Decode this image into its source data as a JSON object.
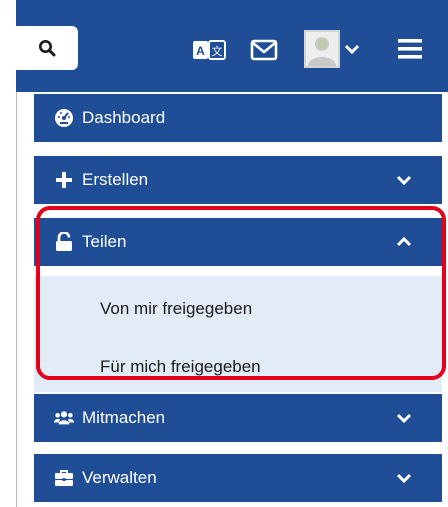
{
  "header": {
    "search_icon": "search-icon",
    "language_icon": "translate-icon",
    "mail_icon": "mail-icon",
    "avatar_icon": "user-avatar-icon",
    "menu_icon": "hamburger-menu-icon",
    "colors": {
      "brand": "#1f4e97",
      "highlight": "#e3001b",
      "submenu": "#e2ecf6"
    }
  },
  "menu": {
    "items": [
      {
        "label": "Dashboard",
        "icon": "dashboard-gauge-icon",
        "expanded": false,
        "has_chevron": false
      },
      {
        "label": "Erstellen",
        "icon": "plus-icon",
        "expanded": false,
        "has_chevron": true
      },
      {
        "label": "Teilen",
        "icon": "unlock-icon",
        "expanded": true,
        "has_chevron": true,
        "subitems": [
          {
            "label": "Von mir freigegeben"
          },
          {
            "label": "Für mich freigegeben"
          }
        ]
      },
      {
        "label": "Mitmachen",
        "icon": "users-icon",
        "expanded": false,
        "has_chevron": true
      },
      {
        "label": "Verwalten",
        "icon": "briefcase-icon",
        "expanded": false,
        "has_chevron": true
      }
    ]
  }
}
